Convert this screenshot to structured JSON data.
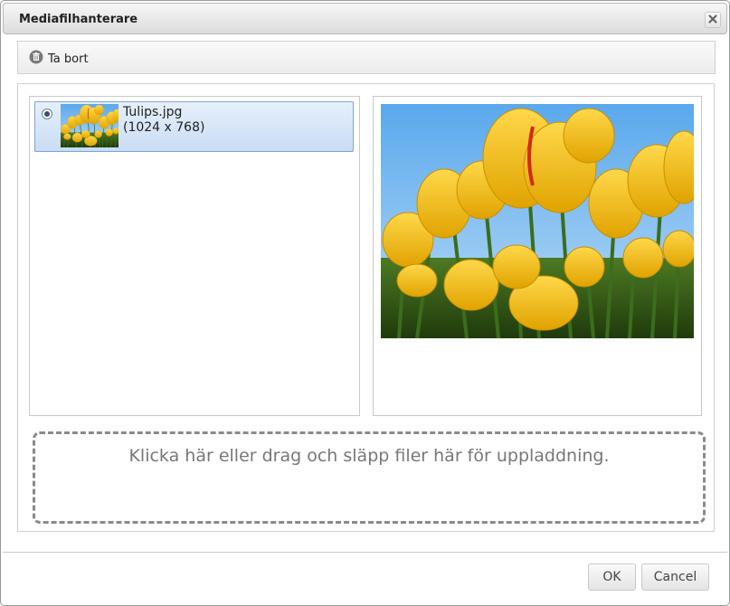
{
  "dialog": {
    "title": "Mediafilhanterare"
  },
  "toolbar": {
    "delete_label": "Ta bort",
    "delete_icon": "trash-icon"
  },
  "files": [
    {
      "name": "Tulips.jpg",
      "dimensions": "(1024 x 768)",
      "selected": true
    }
  ],
  "dropzone": {
    "text": "Klicka här eller drag och släpp filer här för uppladdning."
  },
  "footer": {
    "ok_label": "OK",
    "cancel_label": "Cancel"
  },
  "colors": {
    "selection_bg": "#c9dcf5",
    "selection_border": "#7fa3d1",
    "sky": "#6fb3ee",
    "tulip_yellow": "#f2c012",
    "stem_green": "#3b6d1c"
  }
}
